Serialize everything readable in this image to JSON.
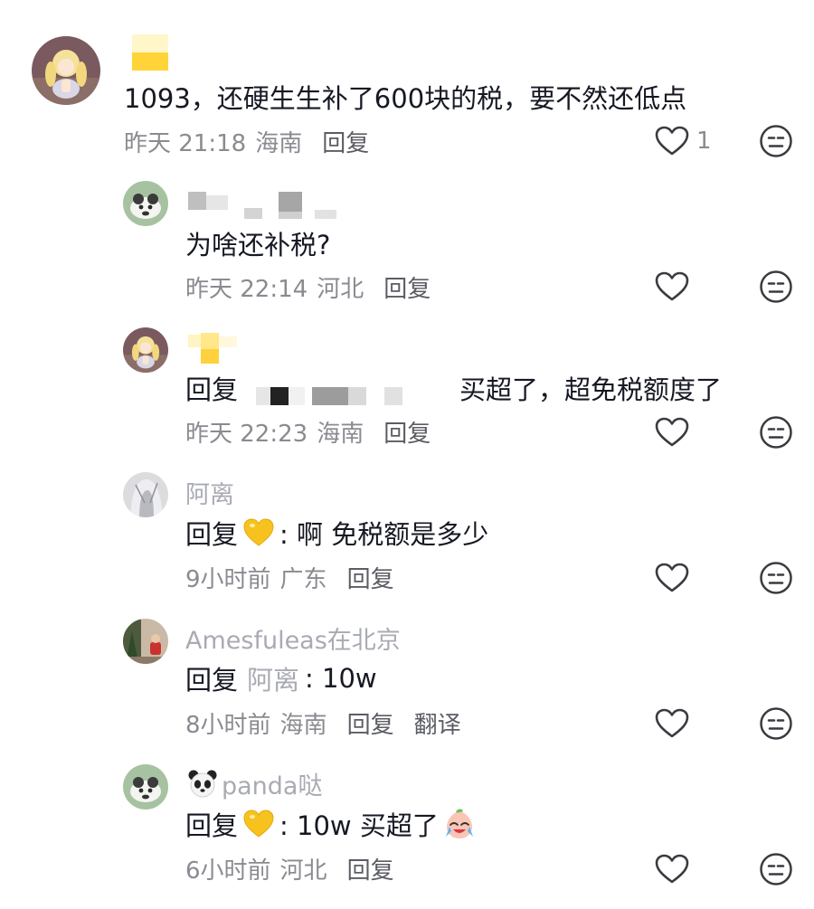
{
  "comments": [
    {
      "username": "",
      "text": "1093，还硬生生补了600块的税，要不然还低点",
      "time": "昨天 21:18",
      "location": "海南",
      "reply_label": "回复",
      "likes": "1"
    },
    {
      "username": "",
      "text": "为啥还补税?",
      "time": "昨天 22:14",
      "location": "河北",
      "reply_label": "回复"
    },
    {
      "username": "",
      "reply_prefix": "回复",
      "text": "买超了，超免税额度了",
      "time": "昨天 22:23",
      "location": "海南",
      "reply_label": "回复"
    },
    {
      "username": "阿离",
      "reply_prefix": "回复",
      "text": ": 啊 免税额是多少",
      "time": "9小时前",
      "location": "广东",
      "reply_label": "回复"
    },
    {
      "username": "Amesfuleas在北京",
      "reply_prefix": "回复",
      "mention": "阿离",
      "text": ": 10w",
      "time": "8小时前",
      "location": "海南",
      "reply_label": "回复",
      "translate_label": "翻译"
    },
    {
      "username": "panda哒",
      "reply_prefix": "回复",
      "text": ": 10w 买超了",
      "time": "6小时前",
      "location": "河北",
      "reply_label": "回复"
    }
  ],
  "icons": {
    "like": "heart-outline-icon",
    "dislike": "neutral-face-icon",
    "emoji_heart": "yellow-heart-emoji",
    "emoji_panda": "panda-face-emoji",
    "emoji_cry": "crying-face-emoji"
  },
  "colors": {
    "primary_text": "#161823",
    "secondary_text": "#8a8b91",
    "username_text": "#a9abb3",
    "icon_stroke": "#3a3b40"
  }
}
